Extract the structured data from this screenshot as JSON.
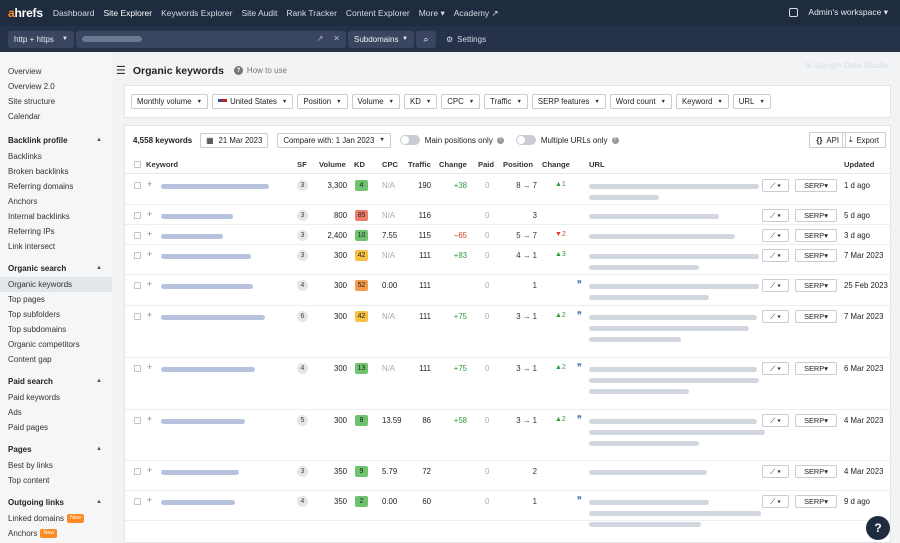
{
  "topbar": {
    "logo_a": "a",
    "logo_rest": "hrefs",
    "nav": [
      "Dashboard",
      "Site Explorer",
      "Keywords Explorer",
      "Site Audit",
      "Rank Tracker",
      "Content Explorer",
      "More ▾",
      "Academy ↗"
    ],
    "workspace": "Admin's workspace ▾"
  },
  "urlbar": {
    "protocol": "http + https",
    "mode": "Subdomains",
    "settings": "Settings",
    "gds": "Google Data Studio"
  },
  "sidebar": {
    "groups": [
      {
        "title": "",
        "items": [
          "Overview",
          "Overview 2.0",
          "Site structure",
          "Calendar"
        ]
      },
      {
        "title": "Backlink profile",
        "items": [
          "Backlinks",
          "Broken backlinks",
          "Referring domains",
          "Anchors",
          "Internal backlinks",
          "Referring IPs",
          "Link intersect"
        ]
      },
      {
        "title": "Organic search",
        "items": [
          "Organic keywords",
          "Top pages",
          "Top subfolders",
          "Top subdomains",
          "Organic competitors",
          "Content gap"
        ]
      },
      {
        "title": "Paid search",
        "items": [
          "Paid keywords",
          "Ads",
          "Paid pages"
        ]
      },
      {
        "title": "Pages",
        "items": [
          "Best by links",
          "Top content"
        ]
      },
      {
        "title": "Outgoing links",
        "items": [
          "Linked domains",
          "Anchors"
        ]
      }
    ],
    "new_badge": "New"
  },
  "page": {
    "title": "Organic keywords",
    "how_to": "How to use"
  },
  "filters": [
    "Monthly volume",
    "United States",
    "Position",
    "Volume",
    "KD",
    "CPC",
    "Traffic",
    "SERP features",
    "Word count",
    "Keyword",
    "URL"
  ],
  "toolbar": {
    "count": "4,558 keywords",
    "date": "21 Mar 2023",
    "compare": "Compare with: 1 Jan 2023",
    "main_positions": "Main positions only",
    "multiple_urls": "Multiple URLs only",
    "api": "API",
    "export": "Export"
  },
  "columns": [
    "Keyword",
    "SF",
    "Volume",
    "KD",
    "CPC",
    "Traffic",
    "Change",
    "Paid",
    "Position",
    "Change",
    "URL",
    "Updated"
  ],
  "colors": {
    "kd_green": "#6fc36f",
    "kd_yellow": "#f6c143",
    "kd_orange": "#f39a4c",
    "kd_red": "#ef7d6b",
    "accent": "#ff8a24"
  },
  "rows": [
    {
      "sf": "3",
      "volume": "3,300",
      "kd": "4",
      "kd_color": "#6fc36f",
      "cpc": "N/A",
      "traffic": "190",
      "tchange": "+38",
      "paid": "0",
      "position": "8 → 7",
      "pchange": "▲1",
      "updated": "1 d ago",
      "quote": false
    },
    {
      "sf": "3",
      "volume": "800",
      "kd": "85",
      "kd_color": "#ef7d6b",
      "cpc": "N/A",
      "traffic": "116",
      "tchange": "",
      "paid": "0",
      "position": "3",
      "pchange": "",
      "updated": "5 d ago",
      "quote": false
    },
    {
      "sf": "3",
      "volume": "2,400",
      "kd": "10",
      "kd_color": "#6fc36f",
      "cpc": "7.55",
      "traffic": "115",
      "tchange": "–65",
      "paid": "0",
      "position": "5 → 7",
      "pchange": "▼2",
      "updated": "3 d ago",
      "quote": false
    },
    {
      "sf": "3",
      "volume": "300",
      "kd": "42",
      "kd_color": "#f6c143",
      "cpc": "N/A",
      "traffic": "111",
      "tchange": "+83",
      "paid": "0",
      "position": "4 → 1",
      "pchange": "▲3",
      "updated": "7 Mar 2023",
      "quote": false
    },
    {
      "sf": "4",
      "volume": "300",
      "kd": "52",
      "kd_color": "#f39a4c",
      "cpc": "0.00",
      "traffic": "111",
      "tchange": "",
      "paid": "0",
      "position": "1",
      "pchange": "",
      "updated": "25 Feb 2023",
      "quote": true
    },
    {
      "sf": "6",
      "volume": "300",
      "kd": "42",
      "kd_color": "#f6c143",
      "cpc": "N/A",
      "traffic": "111",
      "tchange": "+75",
      "paid": "0",
      "position": "3 → 1",
      "pchange": "▲2",
      "updated": "7 Mar 2023",
      "quote": true
    },
    {
      "sf": "4",
      "volume": "300",
      "kd": "13",
      "kd_color": "#6fc36f",
      "cpc": "N/A",
      "traffic": "111",
      "tchange": "+75",
      "paid": "0",
      "position": "3 → 1",
      "pchange": "▲2",
      "updated": "6 Mar 2023",
      "quote": true
    },
    {
      "sf": "5",
      "volume": "300",
      "kd": "8",
      "kd_color": "#6fc36f",
      "cpc": "13.59",
      "traffic": "86",
      "tchange": "+58",
      "paid": "0",
      "position": "3 → 1",
      "pchange": "▲2",
      "updated": "4 Mar 2023",
      "quote": true
    },
    {
      "sf": "3",
      "volume": "350",
      "kd": "9",
      "kd_color": "#6fc36f",
      "cpc": "5.79",
      "traffic": "72",
      "tchange": "",
      "paid": "0",
      "position": "2",
      "pchange": "",
      "updated": "4 Mar 2023",
      "quote": false
    },
    {
      "sf": "4",
      "volume": "350",
      "kd": "2",
      "kd_color": "#6fc36f",
      "cpc": "0.00",
      "traffic": "60",
      "tchange": "",
      "paid": "0",
      "position": "1",
      "pchange": "",
      "updated": "9 d ago",
      "quote": true
    }
  ],
  "serp_label": "SERP",
  "help": "?"
}
